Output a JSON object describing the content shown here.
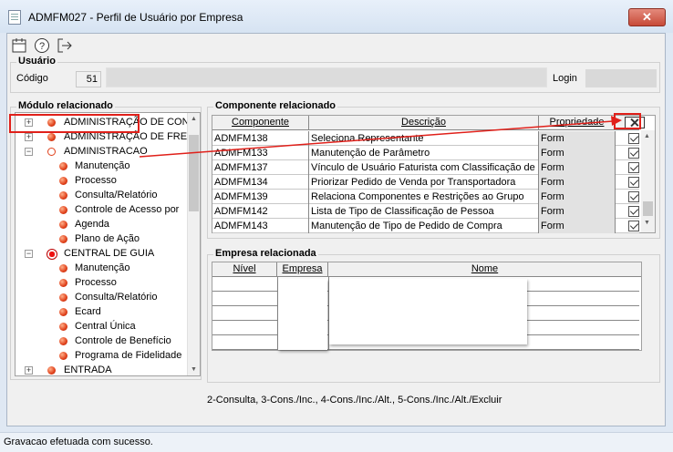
{
  "window": {
    "title": "ADMFM027 - Perfil de Usuário por Empresa",
    "close_glyph": "✕"
  },
  "toolbar": {
    "icons": [
      "calendar-icon",
      "help-icon",
      "exit-icon"
    ]
  },
  "usuario": {
    "group_title": "Usuário",
    "codigo_label": "Código",
    "codigo_value": "51",
    "login_label": "Login"
  },
  "modulo": {
    "group_title": "Módulo relacionado",
    "tree": [
      {
        "label": "ADMINISTRAÇÃO DE CONDO",
        "level": 0,
        "expander": "+",
        "dot": "orange"
      },
      {
        "label": "ADMINISTRAÇÃO DE FRETE",
        "level": 0,
        "expander": "+",
        "dot": "orange"
      },
      {
        "label": "ADMINISTRACAO",
        "level": 0,
        "expander": "−",
        "dot": "hollow"
      },
      {
        "label": "Manutenção",
        "level": 1,
        "dot": "orange"
      },
      {
        "label": "Processo",
        "level": 1,
        "dot": "orange"
      },
      {
        "label": "Consulta/Relatório",
        "level": 1,
        "dot": "orange"
      },
      {
        "label": "Controle de Acesso por",
        "level": 1,
        "dot": "orange"
      },
      {
        "label": "Agenda",
        "level": 1,
        "dot": "orange"
      },
      {
        "label": "Plano de Ação",
        "level": 1,
        "dot": "orange"
      },
      {
        "label": "CENTRAL DE GUIA",
        "level": 0,
        "expander": "−",
        "dot": "big"
      },
      {
        "label": "Manutenção",
        "level": 1,
        "dot": "orange"
      },
      {
        "label": "Processo",
        "level": 1,
        "dot": "orange"
      },
      {
        "label": "Consulta/Relatório",
        "level": 1,
        "dot": "orange"
      },
      {
        "label": "Ecard",
        "level": 1,
        "dot": "orange"
      },
      {
        "label": "Central Única",
        "level": 1,
        "dot": "orange"
      },
      {
        "label": "Controle de Benefício",
        "level": 1,
        "dot": "orange"
      },
      {
        "label": "Programa de Fidelidade",
        "level": 1,
        "dot": "orange"
      },
      {
        "label": "ENTRADA",
        "level": 0,
        "expander": "+",
        "dot": "orange"
      }
    ]
  },
  "componente": {
    "group_title": "Componente relacionado",
    "columns": [
      "Componente",
      "Descrição",
      "Propriedade"
    ],
    "rows": [
      {
        "componente": "ADMFM138",
        "descricao": "Seleciona Representante",
        "propriedade": "Form",
        "checked": true
      },
      {
        "componente": "ADMFM133",
        "descricao": "Manutenção de Parâmetro",
        "propriedade": "Form",
        "checked": true
      },
      {
        "componente": "ADMFM137",
        "descricao": "Vínculo de Usuário Faturista com Classificação de F",
        "propriedade": "Form",
        "checked": true
      },
      {
        "componente": "ADMFM134",
        "descricao": "Priorizar Pedido de Venda por Transportadora",
        "propriedade": "Form",
        "checked": true
      },
      {
        "componente": "ADMFM139",
        "descricao": "Relaciona Componentes e Restrições ao Grupo",
        "propriedade": "Form",
        "checked": true
      },
      {
        "componente": "ADMFM142",
        "descricao": "Lista de Tipo de Classificação de Pessoa",
        "propriedade": "Form",
        "checked": true
      },
      {
        "componente": "ADMFM143",
        "descricao": "Manutenção de Tipo de Pedido de Compra",
        "propriedade": "Form",
        "checked": true
      }
    ]
  },
  "empresa": {
    "group_title": "Empresa relacionada",
    "columns": [
      "Nível",
      "Empresa",
      "Nome"
    ]
  },
  "legend": "2-Consulta, 3-Cons./Inc., 4-Cons./Inc./Alt., 5-Cons./Inc./Alt./Excluir",
  "status": "Gravacao efetuada com sucesso.",
  "colors": {
    "highlight": "#e0201a",
    "tree_dot": "#e0401a"
  }
}
